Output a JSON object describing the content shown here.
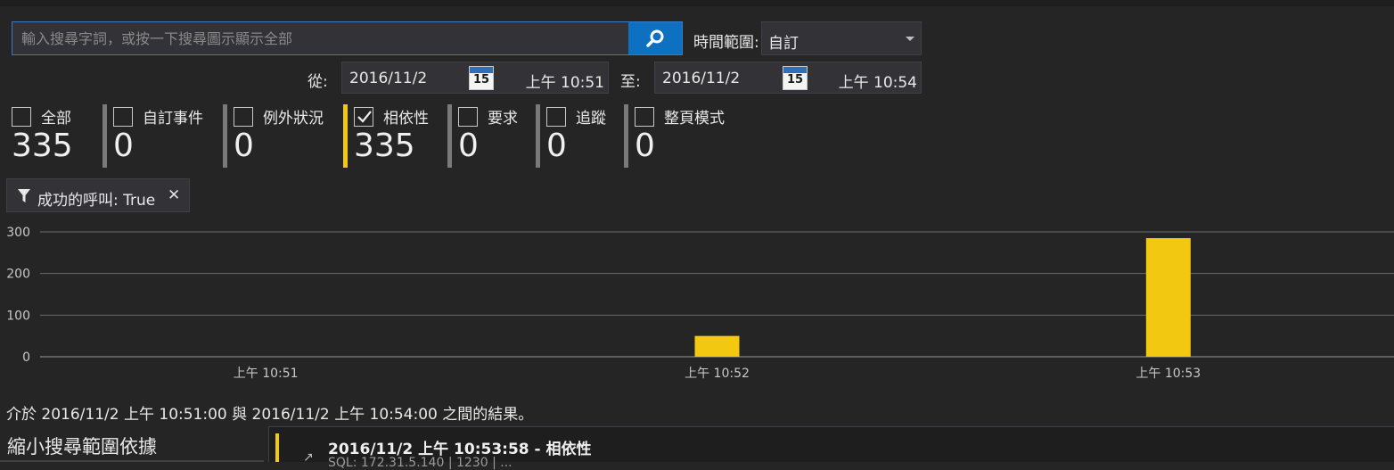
{
  "search": {
    "placeholder": "輸入搜尋字詞，或按一下搜尋圖示顯示全部",
    "value": "",
    "button_icon": "search-icon"
  },
  "time_range": {
    "label": "時間範圍:",
    "selected": "自訂"
  },
  "from": {
    "label": "從:",
    "date": "2016/11/2",
    "time": "上午 10:51",
    "calendar_day": "15"
  },
  "to": {
    "label": "至:",
    "date": "2016/11/2",
    "time": "上午 10:54",
    "calendar_day": "15"
  },
  "categories": [
    {
      "name": "全部",
      "count": "335",
      "checked": false,
      "divider": "none"
    },
    {
      "name": "自訂事件",
      "count": "0",
      "checked": false,
      "divider": "gray"
    },
    {
      "name": "例外狀況",
      "count": "0",
      "checked": false,
      "divider": "gray"
    },
    {
      "name": "相依性",
      "count": "335",
      "checked": true,
      "divider": "yellow"
    },
    {
      "name": "要求",
      "count": "0",
      "checked": false,
      "divider": "gray"
    },
    {
      "name": "追蹤",
      "count": "0",
      "checked": false,
      "divider": "gray"
    },
    {
      "name": "整頁模式",
      "count": "0",
      "checked": false,
      "divider": "gray"
    }
  ],
  "filter_chip": {
    "text": "成功的呼叫: True",
    "close": "✕"
  },
  "colors": {
    "accent_blue": "#0e70c0",
    "bar_yellow": "#f2c811",
    "background": "#252526"
  },
  "chart_data": {
    "type": "bar",
    "categories": [
      "上午 10:51",
      "上午 10:52",
      "上午 10:53"
    ],
    "values": [
      0,
      50,
      285
    ],
    "yticks": [
      "0",
      "100",
      "200",
      "300"
    ],
    "ylim": [
      0,
      300
    ],
    "grid": true,
    "title": "",
    "xlabel": "",
    "ylabel": ""
  },
  "summary": "介於 2016/11/2 上午 10:51:00 與 2016/11/2 上午 10:54:00 之間的結果。",
  "refine": "縮小搜尋範圍依據",
  "result": {
    "title": "2016/11/2 上午 10:53:58 - 相依性",
    "subtitle": "SQL: 172.31.5.140 | 1230 | ..."
  }
}
